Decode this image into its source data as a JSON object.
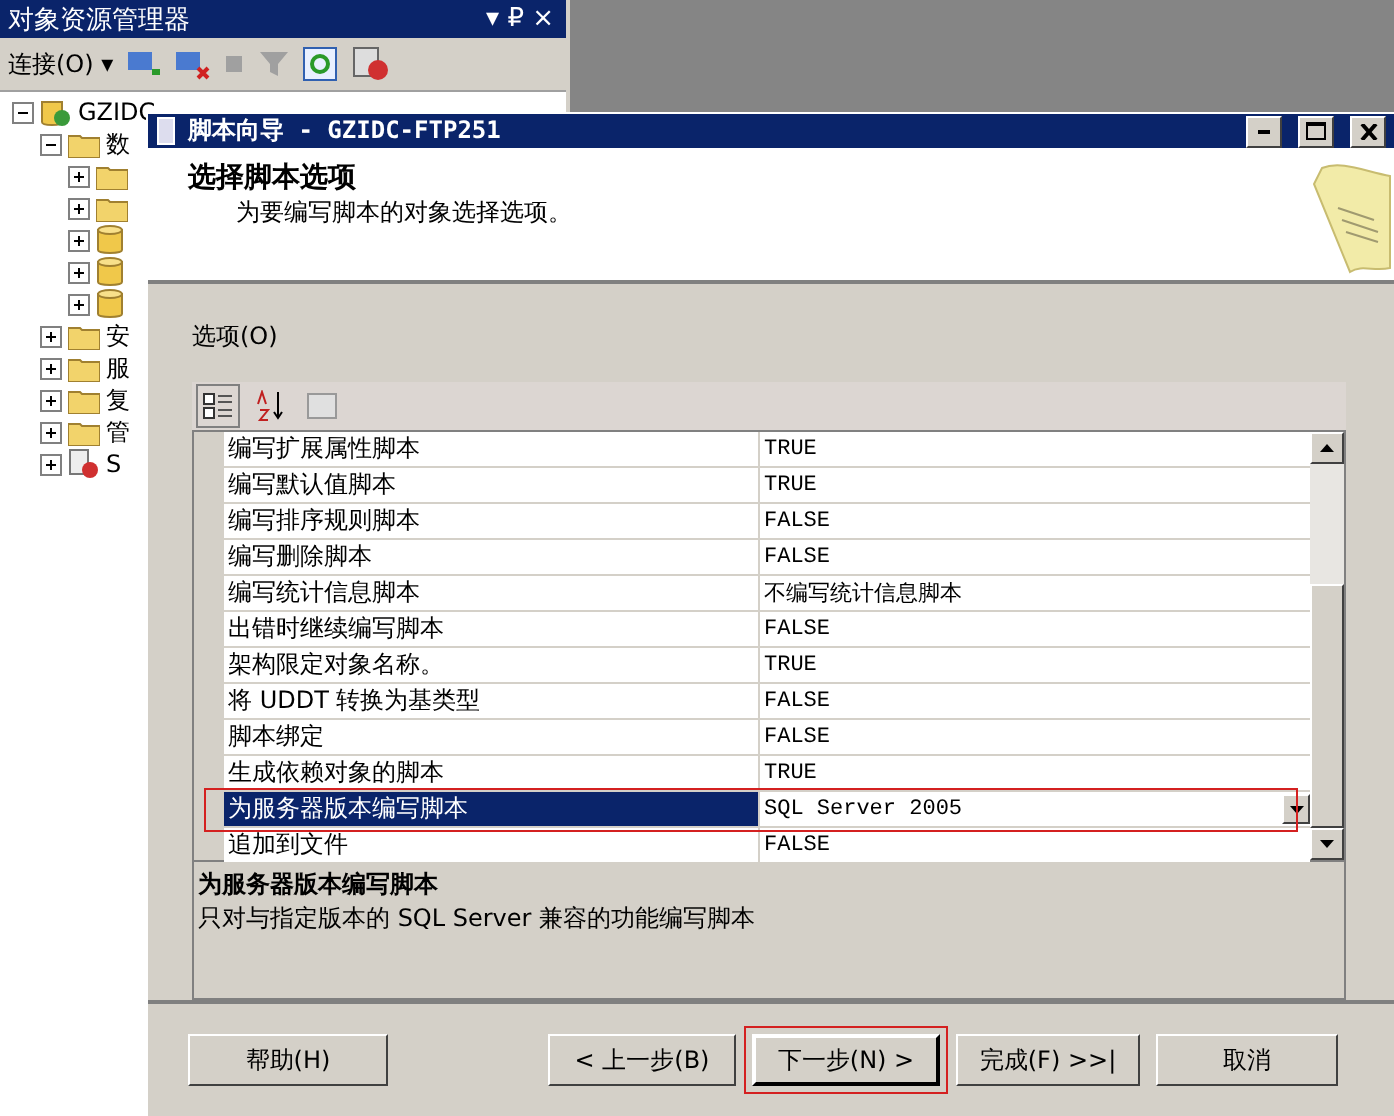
{
  "explorer": {
    "title": "对象资源管理器",
    "pin": "▾ ₽ ×",
    "connect": "连接(O) ▾",
    "tree": [
      {
        "label": "GZIDC",
        "kind": "server",
        "expanded": true,
        "children": [
          {
            "label": "数",
            "kind": "folder",
            "expanded": true,
            "children": [
              {
                "kind": "folder",
                "expanded": false
              },
              {
                "kind": "folder",
                "expanded": false
              },
              {
                "kind": "database",
                "expanded": false
              },
              {
                "kind": "database",
                "expanded": false
              },
              {
                "kind": "database",
                "expanded": false
              }
            ]
          },
          {
            "label": "安",
            "kind": "folder",
            "expanded": false
          },
          {
            "label": "服",
            "kind": "folder",
            "expanded": false
          },
          {
            "label": "复",
            "kind": "folder",
            "expanded": false
          },
          {
            "label": "管",
            "kind": "folder",
            "expanded": false
          },
          {
            "label": "S",
            "kind": "agent",
            "expanded": false
          }
        ]
      }
    ]
  },
  "wizard": {
    "title": "脚本向导 - GZIDC-FTP251",
    "heading": "选择脚本选项",
    "subheading": "为要编写脚本的对象选择选项。",
    "options_label": "选项(O)",
    "properties": [
      {
        "name": "编写扩展属性脚本",
        "value": "TRUE",
        "kind": "text",
        "selected": false
      },
      {
        "name": "编写默认值脚本",
        "value": "TRUE",
        "kind": "text",
        "selected": false
      },
      {
        "name": "编写排序规则脚本",
        "value": "FALSE",
        "kind": "text",
        "selected": false
      },
      {
        "name": "编写删除脚本",
        "value": "FALSE",
        "kind": "text",
        "selected": false
      },
      {
        "name": "编写统计信息脚本",
        "value": "不编写统计信息脚本",
        "kind": "text",
        "selected": false
      },
      {
        "name": "出错时继续编写脚本",
        "value": "FALSE",
        "kind": "text",
        "selected": false
      },
      {
        "name": "架构限定对象名称。",
        "value": "TRUE",
        "kind": "text",
        "selected": false
      },
      {
        "name": "将 UDDT 转换为基类型",
        "value": "FALSE",
        "kind": "text",
        "selected": false
      },
      {
        "name": "脚本绑定",
        "value": "FALSE",
        "kind": "text",
        "selected": false
      },
      {
        "name": "生成依赖对象的脚本",
        "value": "TRUE",
        "kind": "text",
        "selected": false
      },
      {
        "name": "为服务器版本编写脚本",
        "value": "SQL Server 2005",
        "kind": "dropdown",
        "selected": true,
        "highlighted": true
      },
      {
        "name": "追加到文件",
        "value": "FALSE",
        "kind": "text",
        "selected": false
      }
    ],
    "description": {
      "title": "为服务器版本编写脚本",
      "text": "只对与指定版本的 SQL Server 兼容的功能编写脚本"
    },
    "buttons": [
      {
        "label": "帮助(H)",
        "default": false
      },
      {
        "label": "< 上一步(B)",
        "default": false
      },
      {
        "label": "下一步(N) >",
        "default": true,
        "highlighted": true
      },
      {
        "label": "完成(F) >>|",
        "default": false
      },
      {
        "label": "取消",
        "default": false
      }
    ]
  }
}
